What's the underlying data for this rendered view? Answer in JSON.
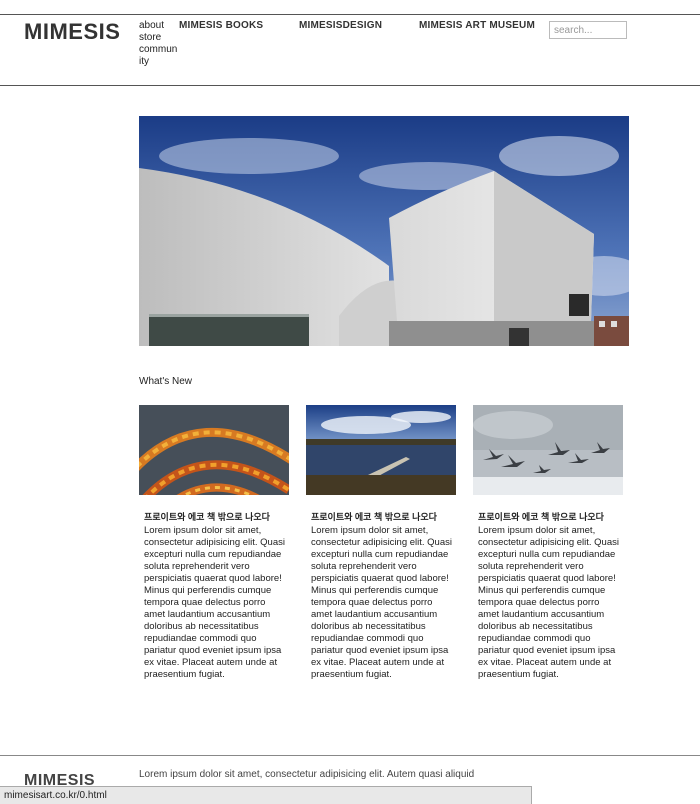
{
  "header": {
    "logo": "MIMESIS",
    "small_nav": [
      "about",
      "store",
      "community"
    ],
    "main_nav": [
      "MIMESIS BOOKS",
      "MIMESISDESIGN",
      "MIMESIS ART MUSEUM"
    ],
    "search_placeholder": "search..."
  },
  "hero": {
    "icon": "museum-building-photo"
  },
  "whats_new": {
    "heading": "What's New"
  },
  "cards": [
    {
      "title": "프로이트와 에코 책 밖으로 나오다",
      "body": "Lorem ipsum dolor sit amet, consectetur adipisicing elit. Quasi excepturi nulla cum repudiandae soluta reprehenderit vero perspiciatis quaerat quod labore! Minus qui perferendis cumque tempora quae delectus porro amet laudantium accusantium doloribus ab necessitatibus repudiandae commodi quo pariatur quod eveniet ipsum ipsa ex vitae. Placeat autem unde at praesentium fugiat.",
      "image": "braided-rope-photo"
    },
    {
      "title": "프로이트와 에코 책 밖으로 나오다",
      "body": "Lorem ipsum dolor sit amet, consectetur adipisicing elit. Quasi excepturi nulla cum repudiandae soluta reprehenderit vero perspiciatis quaerat quod labore! Minus qui perferendis cumque tempora quae delectus porro amet laudantium accusantium doloribus ab necessitatibus repudiandae commodi quo pariatur quod eveniet ipsum ipsa ex vitae. Placeat autem unde at praesentium fugiat.",
      "image": "lake-pier-photo"
    },
    {
      "title": "프로이트와 에코 책 밖으로 나오다",
      "body": "Lorem ipsum dolor sit amet, consectetur adipisicing elit. Quasi excepturi nulla cum repudiandae soluta reprehenderit vero perspiciatis quaerat quod labore! Minus qui perferendis cumque tempora quae delectus porro amet laudantium accusantium doloribus ab necessitatibus repudiandae commodi quo pariatur quod eveniet ipsum ipsa ex vitae. Placeat autem unde at praesentium fugiat.",
      "image": "geese-flying-photo"
    }
  ],
  "footer": {
    "logo": "MIMESIS",
    "text": "Lorem ipsum dolor sit amet, consectetur adipisicing elit. Autem quasi aliquid"
  },
  "statusbar": {
    "url": "mimesisart.co.kr/0.html"
  }
}
